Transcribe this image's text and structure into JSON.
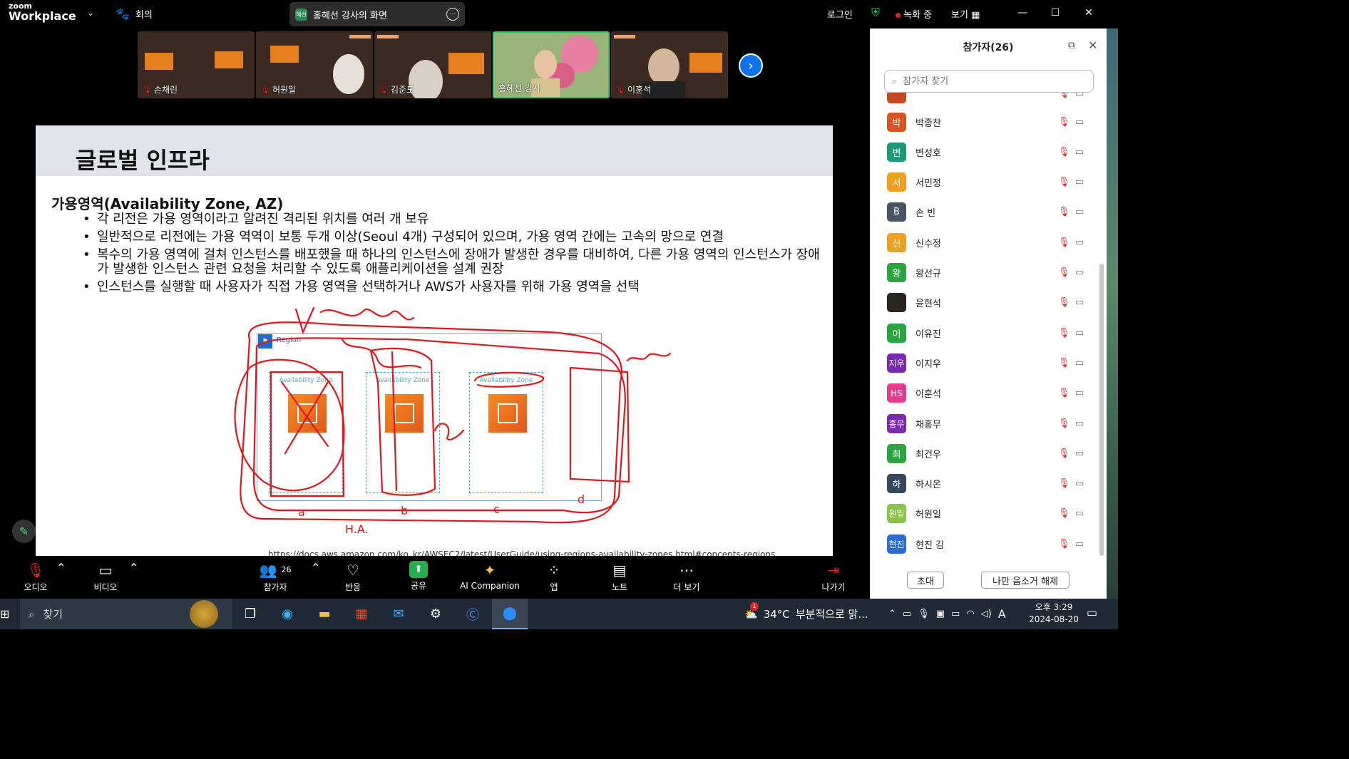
{
  "app": {
    "logo_line1": "zoom",
    "logo_line2": "Workplace"
  },
  "topbar": {
    "meeting_label": "회의",
    "share_tag": "혜선",
    "share_title": "홍혜선 강사의 화면",
    "login": "로그인",
    "recording": "녹화 중",
    "view": "보기",
    "minimize_icon": "minimize-icon",
    "maximize_icon": "maximize-icon",
    "close_icon": "close-icon"
  },
  "videos": [
    {
      "name": "손채린",
      "muted": true
    },
    {
      "name": "허원일",
      "muted": true
    },
    {
      "name": "김준도",
      "muted": true
    },
    {
      "name": "홍혜선 강사",
      "muted": false,
      "active": true
    },
    {
      "name": "이훈석",
      "muted": true
    }
  ],
  "slide": {
    "title": "글로벌 인프라",
    "subtitle": "가용영역(Availability Zone, AZ)",
    "bullets": [
      "각 리전은 가용 영역이라고 알려진 격리된 위치를 여러 개 보유",
      "일반적으로 리전에는 가용 역역이 보통 두개 이상(Seoul 4개) 구성되어 있으며, 가용 영역 간에는 고속의 망으로 연결",
      "복수의 가용 영역에 걸쳐 인스턴스를 배포했을 때 하나의 인스턴스에 장애가 발생한 경우를 대비하여, 다른 가용 영역의 인스턴스가 장애가 발생한 인스턴스 관련 요청을 처리할 수 있도록 애플리케이션을 설계 권장",
      "인스턴스를 실행할 때 사용자가 직접 가용 영역을 선택하거나 AWS가 사용자를 위해 가용 영역을 선택"
    ],
    "diagram": {
      "region_label": "Region",
      "az_labels": [
        "Availability Zone",
        "Availability Zone",
        "Availability Zone"
      ]
    },
    "annotations": {
      "a": "a",
      "b": "b",
      "c": "c",
      "d": "d",
      "ha": "H.A."
    },
    "url": "https://docs.aws.amazon.com/ko_kr/AWSEC2/latest/UserGuide/using-regions-availability-zones.html#concepts-regions"
  },
  "panel": {
    "title": "참가자(26)",
    "search_placeholder": "참가자 찾기",
    "participants": [
      {
        "name": "박종찬",
        "initial": "박",
        "color": "#d9541e"
      },
      {
        "name": "변성호",
        "initial": "변",
        "color": "#1a9a78"
      },
      {
        "name": "서민정",
        "initial": "서",
        "color": "#f0a020"
      },
      {
        "name": "손 빈",
        "initial": "B",
        "color": "#4a5563"
      },
      {
        "name": "신수정",
        "initial": "신",
        "color": "#f0a020"
      },
      {
        "name": "왕선규",
        "initial": "왕",
        "color": "#2aa640"
      },
      {
        "name": "윤현석",
        "initial": "",
        "color": "#2a2520"
      },
      {
        "name": "이유진",
        "initial": "이",
        "color": "#2aa640"
      },
      {
        "name": "이지우",
        "initial": "지우",
        "color": "#7a2ab0"
      },
      {
        "name": "이훈석",
        "initial": "HS",
        "color": "#e63c8c"
      },
      {
        "name": "채홍무",
        "initial": "홍무",
        "color": "#7a2ab0"
      },
      {
        "name": "최건우",
        "initial": "최",
        "color": "#2aa640"
      },
      {
        "name": "하시온",
        "initial": "하",
        "color": "#34495e"
      },
      {
        "name": "허원일",
        "initial": "원일",
        "color": "#8bc34a"
      },
      {
        "name": "현진 김",
        "initial": "현진",
        "color": "#2b6cd4"
      }
    ],
    "invite": "초대",
    "unmute_me": "나만 음소거 해제"
  },
  "toolbar": {
    "audio": "오디오",
    "video": "비디오",
    "participants": "참가자",
    "participants_count": "26",
    "reactions": "반응",
    "share": "공유",
    "ai": "AI Companion",
    "apps": "앱",
    "notes": "노트",
    "more": "더 보기",
    "leave": "나가기"
  },
  "taskbar": {
    "search": "찾기",
    "weather_temp": "34°C",
    "weather_text": "부분적으로 맑...",
    "weather_badge": "1",
    "ime": "A",
    "time": "오후 3:29",
    "date": "2024-08-20"
  }
}
